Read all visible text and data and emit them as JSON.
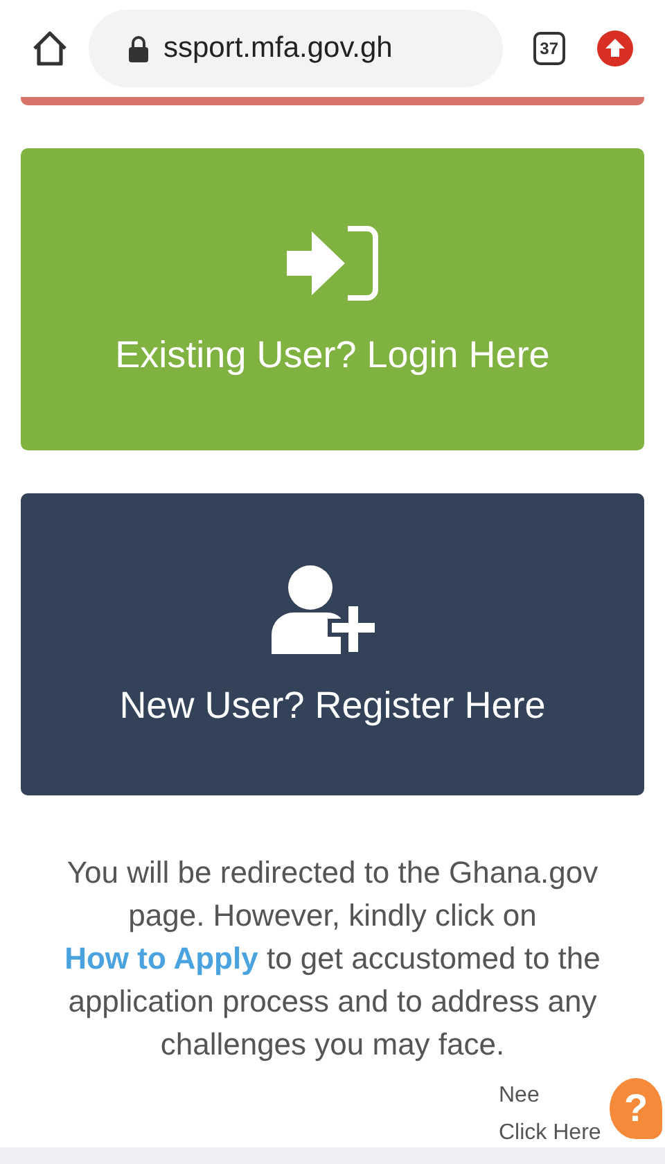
{
  "browser": {
    "url": "ssport.mfa.gov.gh",
    "tab_count": "37"
  },
  "cards": [
    {
      "kind": "login",
      "label": "Existing User? Login Here"
    },
    {
      "kind": "register",
      "label": "New User? Register Here"
    }
  ],
  "notice": {
    "before": "You will be redirected to the Ghana.gov page. However, kindly click on",
    "link": "How to Apply",
    "after": "to get accustomed to the application process and to address any challenges you may face."
  },
  "help": {
    "line1": "Nee",
    "line2": "Click Here",
    "icon": "?"
  }
}
